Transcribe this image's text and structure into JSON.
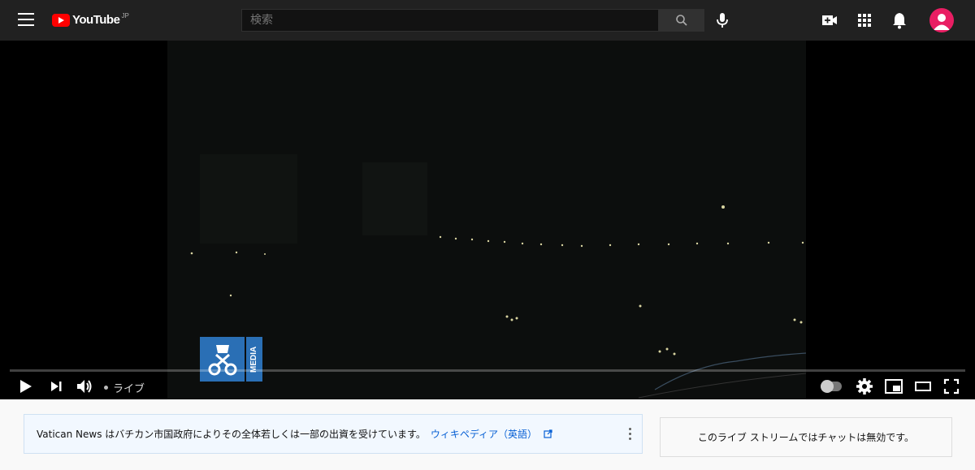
{
  "header": {
    "logo_text": "YouTube",
    "logo_region": "JP",
    "search_placeholder": "検索",
    "icons": [
      "menu-icon",
      "search-icon",
      "mic-icon",
      "create-video-icon",
      "apps-icon",
      "notifications-icon",
      "avatar"
    ]
  },
  "player": {
    "live_label": "ライブ",
    "watermark_text": "MEDIA",
    "controls": [
      "play-icon",
      "next-icon",
      "volume-icon",
      "autoplay-toggle",
      "settings-icon",
      "miniplayer-icon",
      "theater-icon",
      "fullscreen-icon"
    ]
  },
  "info_panel": {
    "text": "Vatican News はバチカン市国政府によりその全体若しくは一部の出資を受けています。",
    "link_text": "ウィキペディア（英語）"
  },
  "chat": {
    "disabled_text": "このライブ ストリームではチャットは無効です。"
  },
  "colors": {
    "topbar": "#212121",
    "brand_red": "#ff0000",
    "link": "#065fd4",
    "avatar": "#e91e63"
  }
}
